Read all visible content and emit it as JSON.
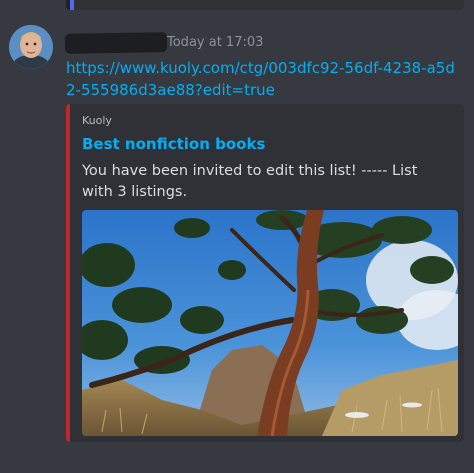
{
  "message": {
    "timestamp": "Today at 17:03",
    "link": "https://www.kuoly.com/ctg/003dfc92-56df-4238-a5d2-555986d3ae88?edit=true"
  },
  "embed": {
    "provider": "Kuoly",
    "title": "Best nonfiction books",
    "description": "You have been invited to edit this list! ----- List with 3 listings."
  },
  "colors": {
    "background": "#36393f",
    "embed_background": "#2f3136",
    "embed_accent": "#c2262b",
    "link": "#00aff4"
  }
}
